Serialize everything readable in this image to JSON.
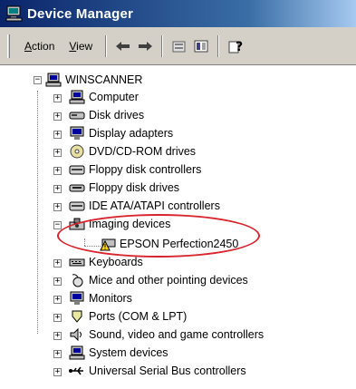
{
  "window": {
    "title": "Device Manager",
    "title_icon": "computer-monitor-icon"
  },
  "toolbar": {
    "menu": [
      {
        "label": "Action",
        "accel": "A"
      },
      {
        "label": "View",
        "accel": "V"
      }
    ],
    "buttons": [
      "back-arrow-icon",
      "forward-arrow-icon",
      "properties-icon",
      "view-toggle-icon",
      "help-icon"
    ]
  },
  "tree": {
    "root": {
      "label": "WINSCANNER",
      "icon": "computer-icon",
      "expanded": true
    },
    "categories": [
      {
        "label": "Computer",
        "icon": "computer-icon",
        "expanded": false
      },
      {
        "label": "Disk drives",
        "icon": "disk-drive-icon",
        "expanded": false
      },
      {
        "label": "Display adapters",
        "icon": "display-adapter-icon",
        "expanded": false
      },
      {
        "label": "DVD/CD-ROM drives",
        "icon": "cdrom-icon",
        "expanded": false
      },
      {
        "label": "Floppy disk controllers",
        "icon": "controller-icon",
        "expanded": false
      },
      {
        "label": "Floppy disk drives",
        "icon": "floppy-drive-icon",
        "expanded": false
      },
      {
        "label": "IDE ATA/ATAPI controllers",
        "icon": "controller-icon",
        "expanded": false
      },
      {
        "label": "Imaging devices",
        "icon": "imaging-device-icon",
        "expanded": true,
        "children": [
          {
            "label": "EPSON Perfection2450",
            "icon": "scanner-warning-icon"
          }
        ]
      },
      {
        "label": "Keyboards",
        "icon": "keyboard-icon",
        "expanded": false
      },
      {
        "label": "Mice and other pointing devices",
        "icon": "mouse-icon",
        "expanded": false
      },
      {
        "label": "Monitors",
        "icon": "monitor-icon",
        "expanded": false
      },
      {
        "label": "Ports (COM & LPT)",
        "icon": "port-icon",
        "expanded": false
      },
      {
        "label": "Sound, video and game controllers",
        "icon": "sound-icon",
        "expanded": false
      },
      {
        "label": "System devices",
        "icon": "system-device-icon",
        "expanded": false
      },
      {
        "label": "Universal Serial Bus controllers",
        "icon": "usb-icon",
        "expanded": false
      }
    ]
  },
  "annotation": {
    "color": "#d9232d"
  },
  "colors": {
    "title_bar": "#0a246a",
    "chrome": "#d4d0c8"
  }
}
